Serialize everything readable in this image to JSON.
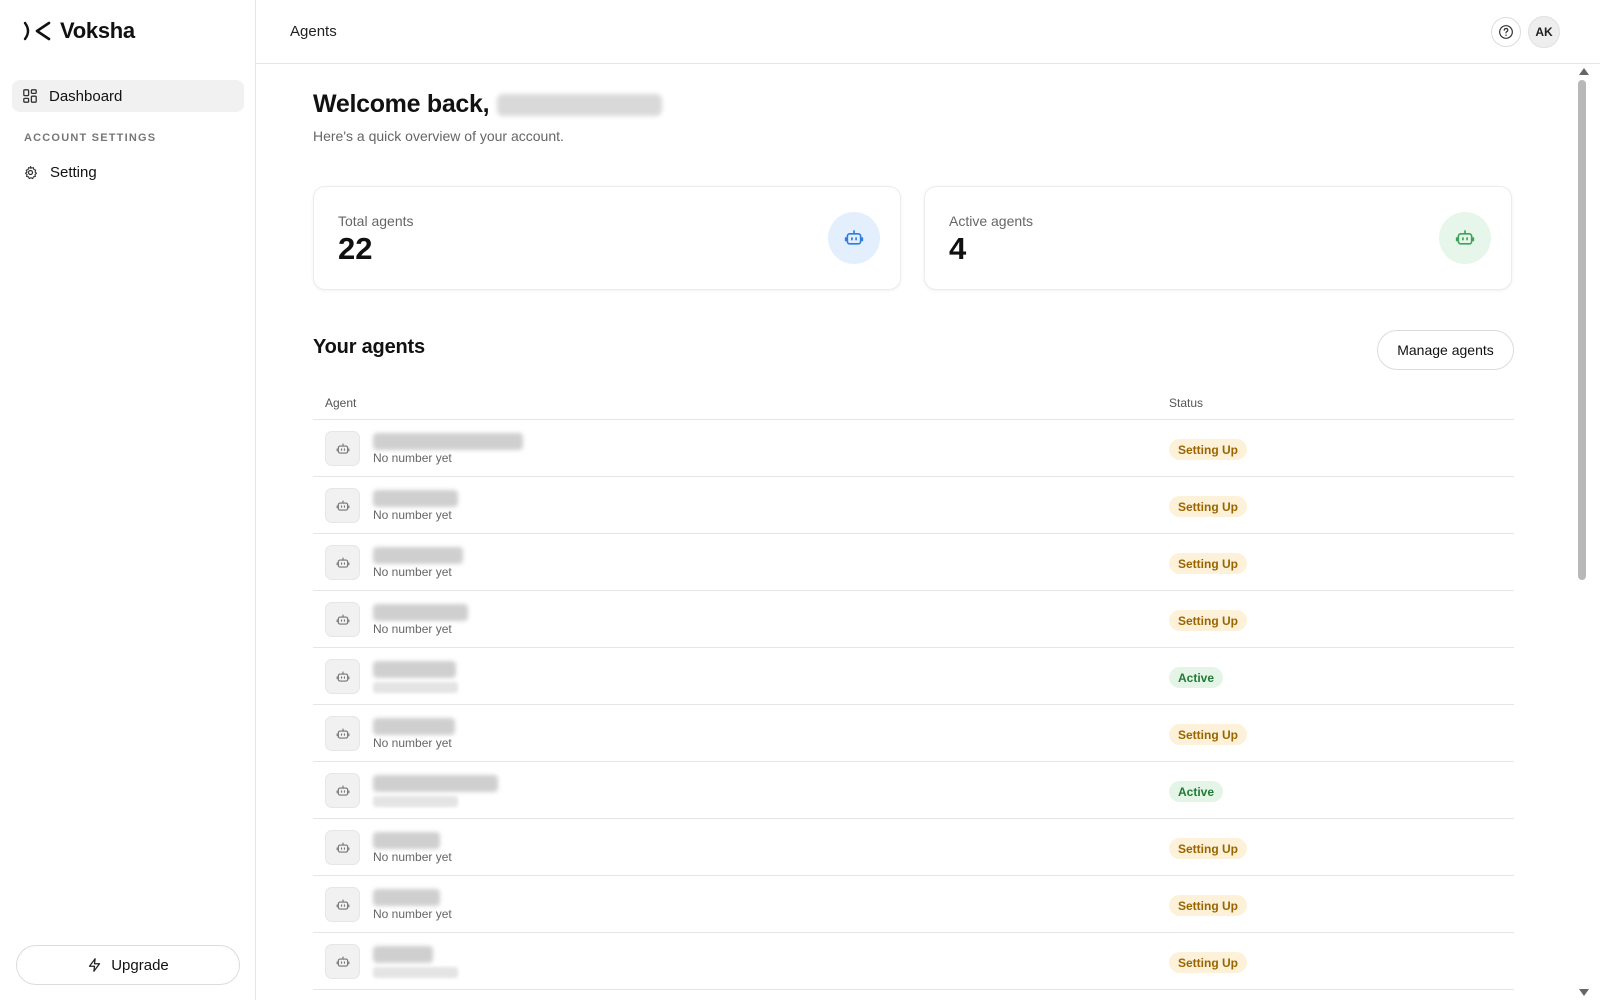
{
  "brand": {
    "name": "Voksha"
  },
  "sidebar": {
    "items": [
      {
        "label": "Dashboard",
        "icon": "dashboard-grid-icon"
      }
    ],
    "section_label": "ACCOUNT SETTINGS",
    "settings_items": [
      {
        "label": "Setting",
        "icon": "gear-icon"
      }
    ],
    "upgrade_label": "Upgrade"
  },
  "topbar": {
    "title": "Agents",
    "avatar_initials": "AK"
  },
  "main": {
    "welcome": "Welcome back,",
    "subtitle": "Here's a quick overview of your account.",
    "stats": [
      {
        "label": "Total agents",
        "value": "22",
        "color": "#2f7be0"
      },
      {
        "label": "Active agents",
        "value": "4",
        "color": "#3da35a"
      }
    ],
    "section_title": "Your agents",
    "manage_label": "Manage agents",
    "table": {
      "headers": {
        "agent": "Agent",
        "status": "Status"
      },
      "rows": [
        {
          "sub": "No number yet",
          "status": "Setting Up"
        },
        {
          "sub": "No number yet",
          "status": "Setting Up"
        },
        {
          "sub": "No number yet",
          "status": "Setting Up"
        },
        {
          "sub": "No number yet",
          "status": "Setting Up"
        },
        {
          "sub": "",
          "status": "Active"
        },
        {
          "sub": "No number yet",
          "status": "Setting Up"
        },
        {
          "sub": "",
          "status": "Active"
        },
        {
          "sub": "No number yet",
          "status": "Setting Up"
        },
        {
          "sub": "No number yet",
          "status": "Setting Up"
        },
        {
          "sub": "",
          "status": "Setting Up"
        }
      ]
    }
  },
  "colors": {
    "setting_up_bg": "#fdf2d9",
    "setting_up_text": "#9a6500",
    "active_bg": "#e4f5e7",
    "active_text": "#217a36"
  }
}
